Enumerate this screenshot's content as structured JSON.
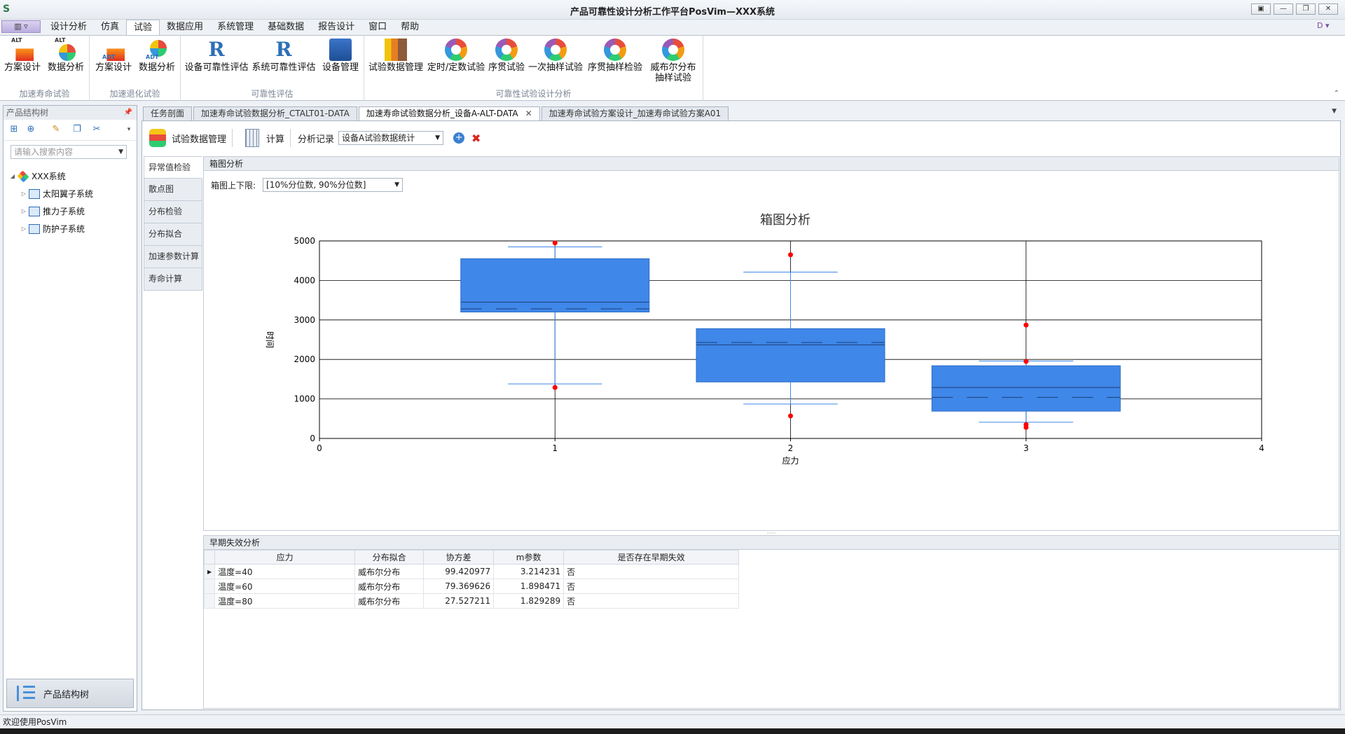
{
  "window": {
    "title": "产品可靠性设计分析工作平台PosVim—XXX系统",
    "buttons": [
      "▣",
      "—",
      "❐",
      "✕"
    ]
  },
  "menu": {
    "app_button": "▥ ▿",
    "tabs": [
      "设计分析",
      "仿真",
      "试验",
      "数据应用",
      "系统管理",
      "基础数据",
      "报告设计",
      "窗口",
      "帮助"
    ],
    "active_tab": "试验",
    "user_badge": "D ▾"
  },
  "ribbon": {
    "groups": [
      {
        "title": "加速寿命试验",
        "buttons": [
          {
            "label": "方案设计",
            "tag": "ALT"
          },
          {
            "label": "数据分析",
            "tag": "ALT"
          }
        ]
      },
      {
        "title": "加速退化试验",
        "buttons": [
          {
            "label": "方案设计",
            "tag": "ADT"
          },
          {
            "label": "数据分析",
            "tag": "ADT"
          }
        ]
      },
      {
        "title": "可靠性评估",
        "buttons": [
          {
            "label": "设备可靠性评估"
          },
          {
            "label": "系统可靠性评估"
          },
          {
            "label": "设备管理"
          }
        ]
      },
      {
        "title": "可靠性试验设计分析",
        "buttons": [
          {
            "label": "试验数据管理"
          },
          {
            "label": "定时/定数试验"
          },
          {
            "label": "序贯试验"
          },
          {
            "label": "一次抽样试验"
          },
          {
            "label": "序贯抽样检验"
          },
          {
            "label": "威布尔分布\n抽样试验"
          }
        ]
      }
    ],
    "collapse_icon": "⌃"
  },
  "left_panel": {
    "title": "产品结构树",
    "search_placeholder": "请输入搜索内容",
    "tree": {
      "root": "XXX系统",
      "children": [
        "太阳翼子系统",
        "推力子系统",
        "防护子系统"
      ]
    },
    "bottom_button": "产品结构树"
  },
  "doc_tabs": [
    {
      "label": "任务剖面"
    },
    {
      "label": "加速寿命试验数据分析_CTALT01-DATA"
    },
    {
      "label": "加速寿命试验数据分析_设备A-ALT-DATA",
      "active": true
    },
    {
      "label": "加速寿命试验方案设计_加速寿命试验方案A01"
    }
  ],
  "doc_toolbar": {
    "manage_label": "试验数据管理",
    "calc_label": "计算",
    "record_label": "分析记录",
    "record_value": "设备A试验数据统计"
  },
  "vertical_tabs": [
    "异常值检验",
    "散点图",
    "分布检验",
    "分布拟合",
    "加速参数计算",
    "寿命计算"
  ],
  "active_vertical_tab": "异常值检验",
  "boxplot_panel": {
    "header": "箱图分析",
    "limit_label": "箱图上下限:",
    "limit_value": "[10%分位数, 90%分位数]"
  },
  "chart_data": {
    "type": "box",
    "title": "箱图分析",
    "xlabel": "应力",
    "ylabel": "时间",
    "xlim": [
      0,
      4
    ],
    "ylim": [
      0,
      5000
    ],
    "xticks": [
      0,
      1,
      2,
      3,
      4
    ],
    "yticks": [
      0,
      1000,
      2000,
      3000,
      4000,
      5000
    ],
    "grid": true,
    "box_color": "#3f87e8",
    "outlier_color": "#ff0000",
    "boxes": [
      {
        "x": 1,
        "q1": 3200,
        "median": 3450,
        "mean": 3280,
        "q3": 4550,
        "whisker_low": 1380,
        "whisker_high": 4850,
        "outliers": [
          4950,
          1290
        ]
      },
      {
        "x": 2,
        "q1": 1430,
        "median": 2370,
        "mean": 2430,
        "q3": 2780,
        "whisker_low": 870,
        "whisker_high": 4210,
        "outliers": [
          4650,
          570
        ]
      },
      {
        "x": 3,
        "q1": 690,
        "median": 1290,
        "mean": 1040,
        "q3": 1840,
        "whisker_low": 410,
        "whisker_high": 1960,
        "outliers": [
          2870,
          1950,
          350,
          280
        ]
      }
    ]
  },
  "early_failure": {
    "header": "早期失效分析",
    "columns": [
      "应力",
      "分布拟合",
      "协方差",
      "m参数",
      "是否存在早期失效"
    ],
    "rows": [
      {
        "stress": "温度=40",
        "dist": "威布尔分布",
        "cov": "99.420977",
        "m": "3.214231",
        "early": "否"
      },
      {
        "stress": "温度=60",
        "dist": "威布尔分布",
        "cov": "79.369626",
        "m": "1.898471",
        "early": "否"
      },
      {
        "stress": "温度=80",
        "dist": "威布尔分布",
        "cov": "27.527211",
        "m": "1.829289",
        "early": "否"
      }
    ]
  },
  "status_bar": "欢迎使用PosVim"
}
